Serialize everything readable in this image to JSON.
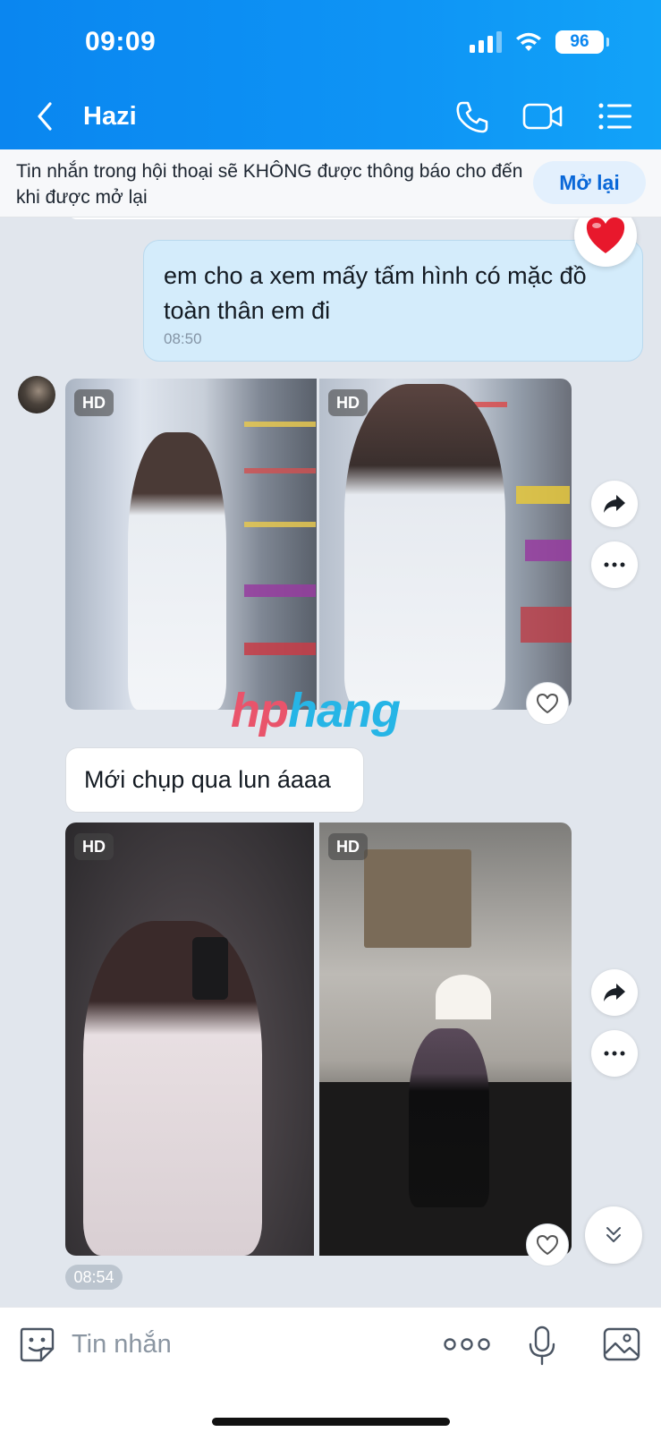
{
  "status_bar": {
    "time": "09:09",
    "battery": "96"
  },
  "header": {
    "contact_name": "Hazi"
  },
  "mute_banner": {
    "text": "Tin nhắn trong hội thoại sẽ KHÔNG được thông báo cho đến khi được mở lại",
    "button_label": "Mở lại"
  },
  "messages": {
    "outgoing_1": {
      "text": "em cho a xem mấy tấm hình có mặc đồ toàn thân em đi",
      "time": "08:50",
      "reaction": "heart-icon"
    },
    "photo_group_1": {
      "badges": [
        "HD",
        "HD"
      ]
    },
    "incoming_text": {
      "text": "Mới chụp qua lun áaaa"
    },
    "photo_group_2": {
      "badges": [
        "HD",
        "HD"
      ],
      "time": "08:54"
    }
  },
  "watermark": {
    "part1": "hp",
    "part2": "hang"
  },
  "composer": {
    "placeholder": "Tin nhắn"
  },
  "colors": {
    "header": "#0a86f0",
    "outgoing_bubble": "#d4ecfb",
    "chat_bg": "#e1e6ed",
    "accent": "#0a68d8"
  }
}
